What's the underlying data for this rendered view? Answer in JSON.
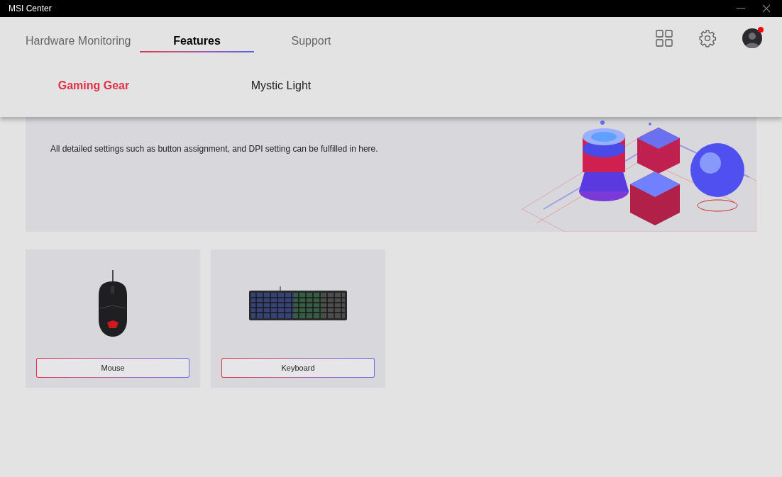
{
  "window": {
    "title": "MSI Center"
  },
  "tabs": [
    {
      "label": "Hardware Monitoring",
      "selected": false
    },
    {
      "label": "Features",
      "selected": true
    },
    {
      "label": "Support",
      "selected": false
    }
  ],
  "account": {
    "notification": true
  },
  "subtabs": [
    {
      "label": "Gaming Gear",
      "selected": true
    },
    {
      "label": "Mystic Light",
      "selected": false
    }
  ],
  "banner": {
    "description": "All detailed settings such as button assignment, and DPI setting can be fulfilled in here."
  },
  "devices": [
    {
      "kind": "mouse",
      "label": "Mouse"
    },
    {
      "kind": "keyboard",
      "label": "Keyboard"
    }
  ]
}
